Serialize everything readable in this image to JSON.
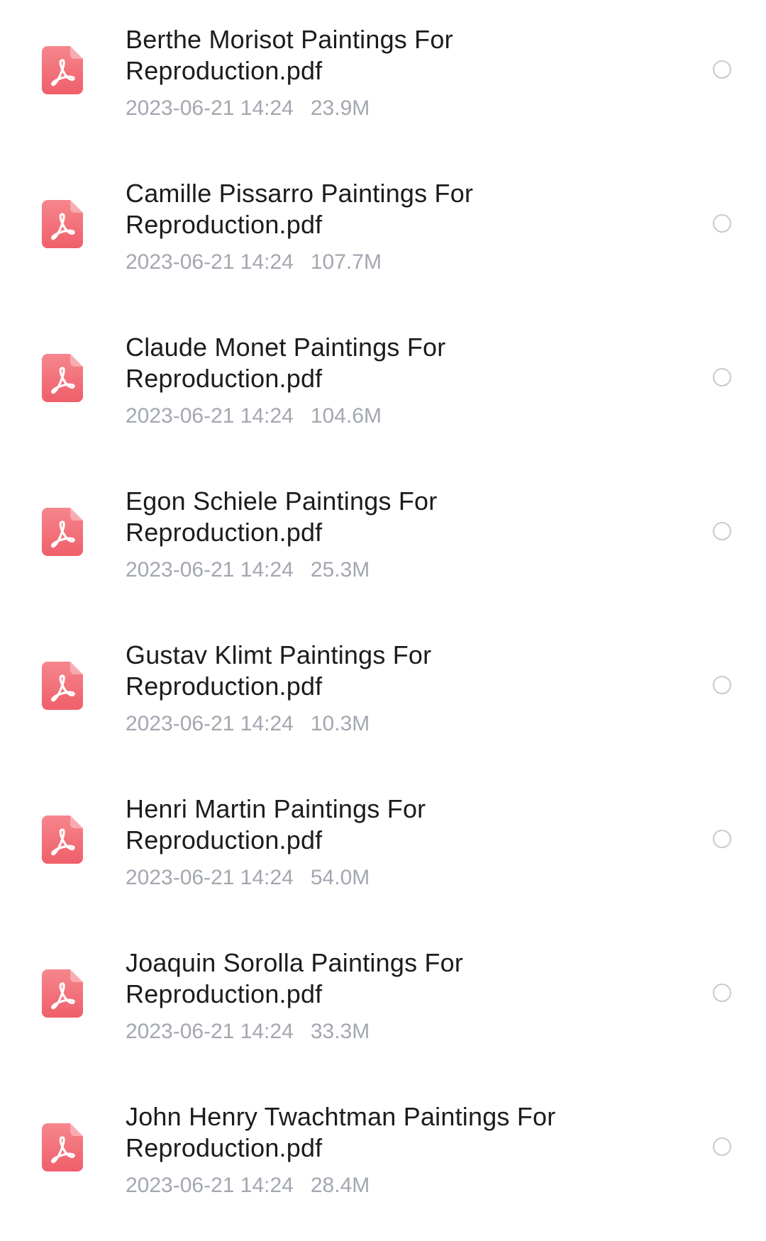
{
  "files": [
    {
      "name_line1": "Berthe Morisot Paintings For",
      "name_line2": "Reproduction.pdf",
      "date": "2023-06-21 14:24",
      "size": "23.9M",
      "icon": "pdf-icon"
    },
    {
      "name_line1": "Camille Pissarro Paintings For",
      "name_line2": "Reproduction.pdf",
      "date": "2023-06-21 14:24",
      "size": "107.7M",
      "icon": "pdf-icon"
    },
    {
      "name_line1": "Claude Monet Paintings For",
      "name_line2": "Reproduction.pdf",
      "date": "2023-06-21 14:24",
      "size": "104.6M",
      "icon": "pdf-icon"
    },
    {
      "name_line1": "Egon Schiele Paintings For",
      "name_line2": "Reproduction.pdf",
      "date": "2023-06-21 14:24",
      "size": "25.3M",
      "icon": "pdf-icon"
    },
    {
      "name_line1": "Gustav Klimt Paintings For",
      "name_line2": "Reproduction.pdf",
      "date": "2023-06-21 14:24",
      "size": "10.3M",
      "icon": "pdf-icon"
    },
    {
      "name_line1": "Henri Martin Paintings For",
      "name_line2": "Reproduction.pdf",
      "date": "2023-06-21 14:24",
      "size": "54.0M",
      "icon": "pdf-icon"
    },
    {
      "name_line1": "Joaquin Sorolla Paintings For",
      "name_line2": "Reproduction.pdf",
      "date": "2023-06-21 14:24",
      "size": "33.3M",
      "icon": "pdf-icon"
    },
    {
      "name_line1": "John Henry Twachtman Paintings For",
      "name_line2": "Reproduction.pdf",
      "date": "2023-06-21 14:24",
      "size": "28.4M",
      "icon": "pdf-icon"
    }
  ],
  "colors": {
    "pdf_icon_top": "#f6868d",
    "pdf_icon_bottom": "#ef5f6a",
    "title_text": "#1c1c1e",
    "meta_text": "#a3a7b0",
    "radio_border": "#c9cacd"
  },
  "selection": {
    "selected_count": 0
  }
}
